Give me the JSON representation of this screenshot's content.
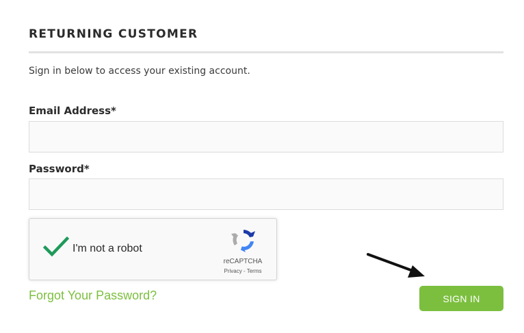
{
  "section": {
    "title": "RETURNING CUSTOMER",
    "intro": "Sign in below to access your existing account."
  },
  "form": {
    "email_label": "Email Address*",
    "email_value": "",
    "password_label": "Password*",
    "password_value": ""
  },
  "recaptcha": {
    "label": "I'm not a robot",
    "brand": "reCAPTCHA",
    "privacy": "Privacy",
    "separator": " - ",
    "terms": "Terms",
    "checked": true
  },
  "actions": {
    "forgot_password": "Forgot Your Password?",
    "sign_in": "SIGN IN"
  },
  "icons": {
    "checkmark": "checkmark-icon",
    "recaptcha_logo": "recaptcha-logo-icon",
    "arrow": "arrow-annotation-icon"
  },
  "colors": {
    "accent": "#7cbf3f",
    "check": "#1e9a5a",
    "rule": "#e2e2e2",
    "input_background": "#fafafa"
  }
}
